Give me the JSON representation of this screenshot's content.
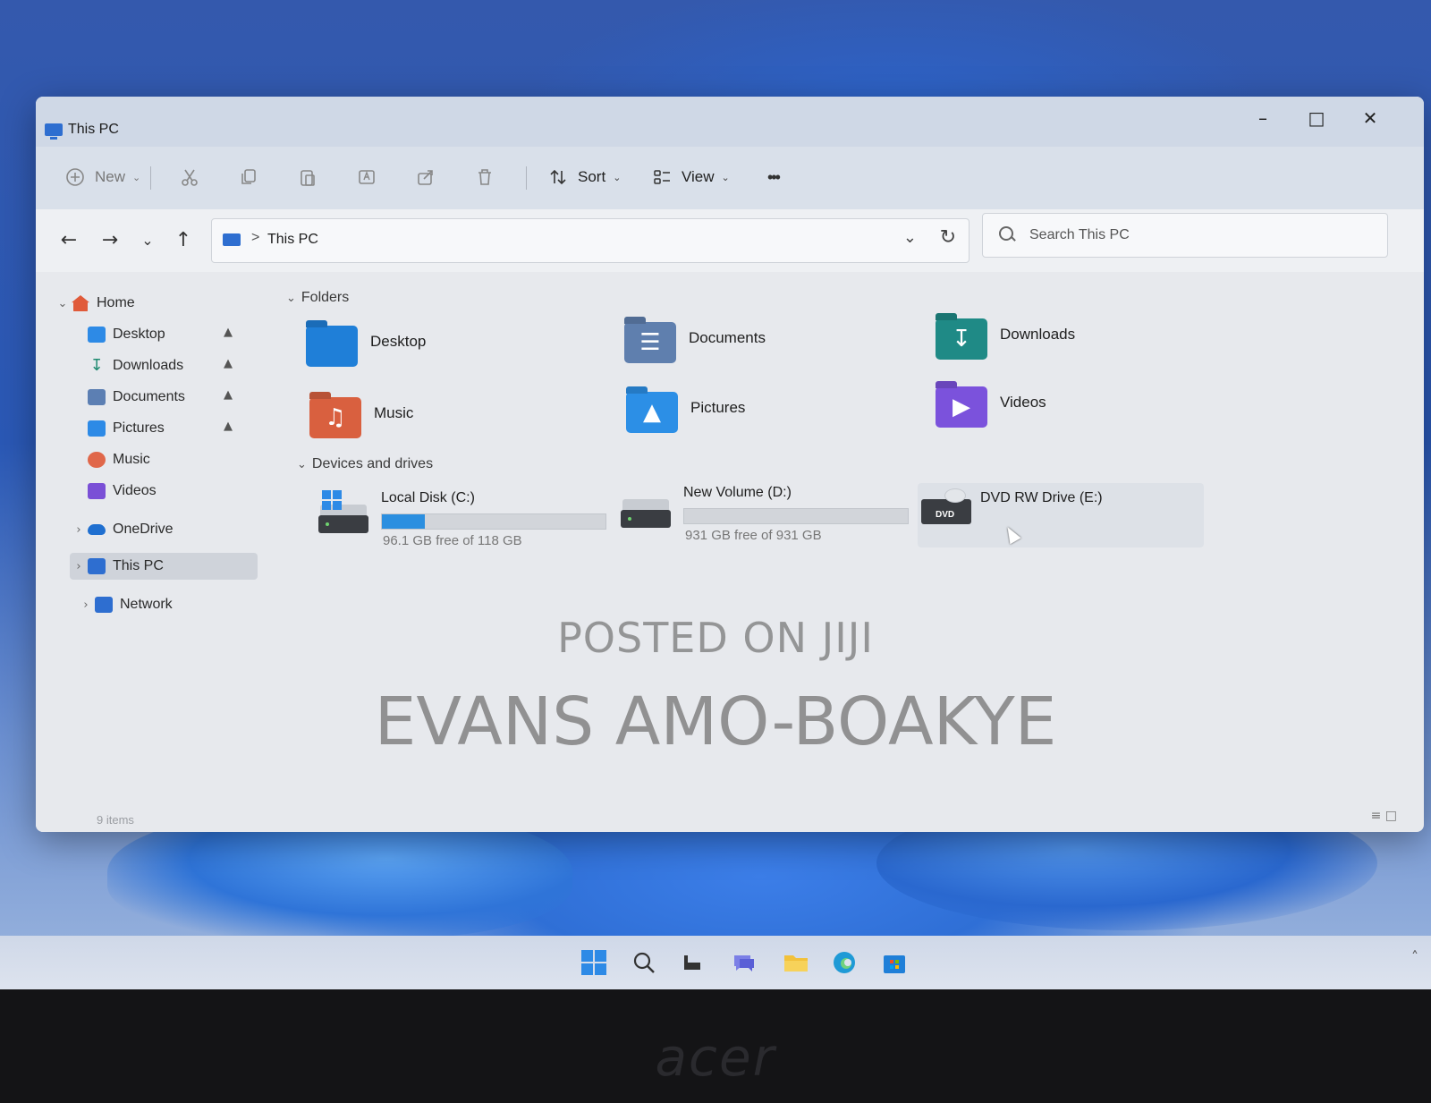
{
  "window": {
    "title": "This PC",
    "controls": {
      "minimize": "–",
      "maximize": "□",
      "close": "✕"
    }
  },
  "commandbar": {
    "new_label": "New",
    "sort_label": "Sort",
    "view_label": "View",
    "more_label": "•••",
    "icons": [
      "cut-icon",
      "copy-icon",
      "paste-icon",
      "rename-icon",
      "share-icon",
      "delete-icon"
    ]
  },
  "navigation": {
    "back": "←",
    "forward": "→",
    "recent": "⌄",
    "up": "↑",
    "address_separator": ">",
    "address_text": "This PC",
    "search_placeholder": "Search This PC"
  },
  "sidebar": {
    "items": [
      {
        "label": "Home",
        "icon": "home-icon",
        "color": "#e05a3a",
        "expanded": true
      },
      {
        "label": "Desktop",
        "icon": "desktop-folder-icon",
        "color": "#2d8ae6",
        "pinned": true
      },
      {
        "label": "Downloads",
        "icon": "downloads-icon",
        "color": "#1f8a70",
        "pinned": true
      },
      {
        "label": "Documents",
        "icon": "documents-folder-icon",
        "color": "#5c7fb3",
        "pinned": true
      },
      {
        "label": "Pictures",
        "icon": "pictures-folder-icon",
        "color": "#2d8ae6",
        "pinned": true
      },
      {
        "label": "Music",
        "icon": "music-folder-icon",
        "color": "#e0674a"
      },
      {
        "label": "Videos",
        "icon": "videos-folder-icon",
        "color": "#7a4fd6"
      },
      {
        "label": "OneDrive",
        "icon": "onedrive-icon",
        "color": "#1f6fd0"
      },
      {
        "label": "This PC",
        "icon": "this-pc-icon",
        "color": "#2e6ed0",
        "selected": true
      },
      {
        "label": "Network",
        "icon": "network-icon",
        "color": "#2e6ed0"
      }
    ],
    "pin_glyph": "📌"
  },
  "folders": {
    "heading": "Folders",
    "items": [
      {
        "label": "Desktop",
        "icon": "desktop-folder-icon",
        "color": "#1f7fd8"
      },
      {
        "label": "Documents",
        "icon": "documents-folder-icon",
        "color": "#5f7fae"
      },
      {
        "label": "Downloads",
        "icon": "downloads-folder-icon",
        "color": "#1f8a86"
      },
      {
        "label": "Music",
        "icon": "music-folder-icon",
        "color": "#d9603f"
      },
      {
        "label": "Pictures",
        "icon": "pictures-folder-icon",
        "color": "#2c8fe6"
      },
      {
        "label": "Videos",
        "icon": "videos-folder-icon",
        "color": "#7b52dc"
      }
    ]
  },
  "drives": {
    "heading": "Devices and drives",
    "items": [
      {
        "label": "Local Disk (C:)",
        "free_text": "96.1 GB free of 118 GB",
        "used_fraction": 0.19,
        "icon": "local-disk-icon"
      },
      {
        "label": "New Volume (D:)",
        "free_text": "931 GB free of 931 GB",
        "used_fraction": 0.0,
        "icon": "hard-drive-icon"
      },
      {
        "label": "DVD RW Drive (E:)",
        "icon": "dvd-drive-icon",
        "badge": "DVD"
      }
    ]
  },
  "statusbar": {
    "items_text": "9 items",
    "view_toggles": "≡ □"
  },
  "watermark": {
    "line1": "POSTED ON JIJI",
    "line2": "EVANS AMO-BOAKYE"
  },
  "taskbar": {
    "icons": [
      "start-icon",
      "search-icon",
      "task-view-icon",
      "chat-icon",
      "file-explorer-icon",
      "edge-icon",
      "store-icon"
    ],
    "tray_chevron": "˄"
  },
  "laptop": {
    "brand": "acer"
  }
}
